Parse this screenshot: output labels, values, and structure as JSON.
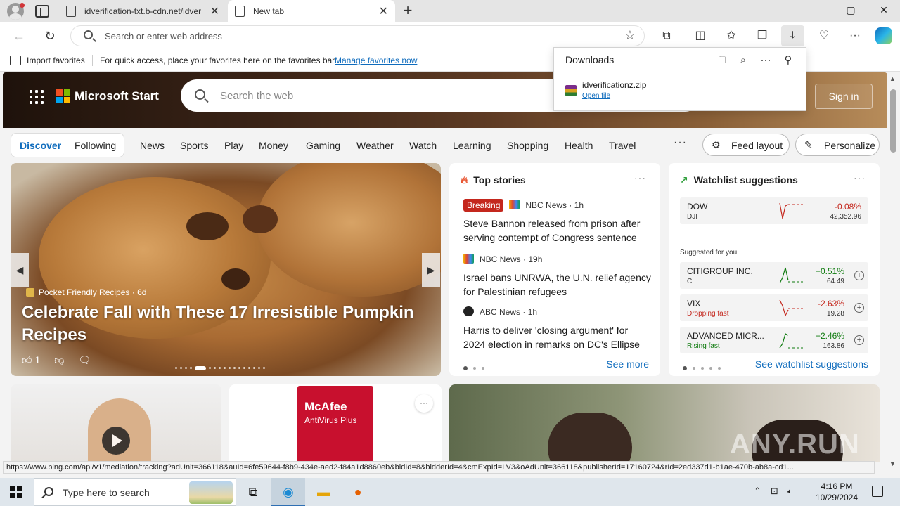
{
  "browser": {
    "tabs": [
      {
        "title": "idverification-txt.b-cdn.net/idver",
        "close": "✕"
      },
      {
        "title": "New tab",
        "close": "✕"
      }
    ],
    "new_tab": "+",
    "window_controls": {
      "minimize": "—",
      "maximize": "▢",
      "close": "✕"
    },
    "address_placeholder": "Search or enter web address",
    "favorites_bar": {
      "import_label": "Import favorites",
      "hint": "For quick access, place your favorites here on the favorites bar.",
      "manage_link": "Manage favorites now"
    },
    "toolbar_icons": [
      "extensions-icon",
      "split-screen-icon",
      "favorites-icon",
      "collections-icon",
      "downloads-icon",
      "browser-essentials-icon",
      "more-icon",
      "copilot-icon"
    ]
  },
  "downloads": {
    "title": "Downloads",
    "file_name": "idverificationz.zip",
    "open_file": "Open file"
  },
  "msstart": {
    "brand": "Microsoft Start",
    "search_placeholder": "Search the web",
    "sign_in": "Sign in",
    "nav": {
      "pill_active": "Discover",
      "pill_other": "Following",
      "links": [
        "News",
        "Sports",
        "Play",
        "Money",
        "Gaming",
        "Weather",
        "Watch",
        "Learning",
        "Shopping",
        "Health",
        "Travel"
      ],
      "more": "···",
      "feed_layout": "Feed layout",
      "personalize": "Personalize"
    },
    "hero": {
      "source": "Pocket Friendly Recipes",
      "age": "6d",
      "title": "Celebrate Fall with These 17 Irresistible Pumpkin Recipes",
      "likes": "1"
    },
    "top_stories": {
      "title": "Top stories",
      "more": "···",
      "items": [
        {
          "badge": "Breaking",
          "source": "NBC News",
          "age": "1h",
          "headline": "Steve Bannon released from prison after serving contempt of Congress sentence"
        },
        {
          "badge": "",
          "source": "NBC News",
          "age": "19h",
          "headline": "Israel bans UNRWA, the U.N. relief agency for Palestinian refugees"
        },
        {
          "badge": "",
          "source": "ABC News",
          "age": "1h",
          "headline": "Harris to deliver 'closing argument' for 2024 election in remarks on DC's Ellipse"
        }
      ],
      "see_more": "See more"
    },
    "watchlist": {
      "title": "Watchlist suggestions",
      "more": "···",
      "dow": {
        "name": "DOW",
        "ticker": "DJI",
        "change": "-0.08%",
        "price": "42,352.96"
      },
      "suggested_label": "Suggested for you",
      "suggestions": [
        {
          "name": "CITIGROUP INC.",
          "ticker": "C",
          "change": "+0.51%",
          "price": "64.49",
          "direction": "up"
        },
        {
          "name": "VIX",
          "ticker": "Dropping fast",
          "change": "-2.63%",
          "price": "19.28",
          "direction": "down"
        },
        {
          "name": "ADVANCED MICR...",
          "ticker": "Rising fast",
          "change": "+2.46%",
          "price": "163.86",
          "direction": "up"
        }
      ],
      "see_all": "See watchlist suggestions"
    },
    "ad_brand": "McAfee",
    "ad_product": "AntiVirus Plus"
  },
  "status_url": "https://www.bing.com/api/v1/mediation/tracking?adUnit=366118&auId=6fe59644-f8b9-434e-aed2-f84a1d8860eb&bidId=8&bidderId=4&cmExpId=LV3&oAdUnit=366118&publisherId=17160724&rId=2ed337d1-b1ae-470b-ab8a-cd1...",
  "watermark": "ANY.RUN",
  "taskbar": {
    "search_placeholder": "Type here to search",
    "time": "4:16 PM",
    "date": "10/29/2024"
  },
  "colors": {
    "accent": "#0f6cbd",
    "negative": "#c4271d",
    "positive": "#0f7b0f",
    "taskbar": "#dfe6ec"
  }
}
